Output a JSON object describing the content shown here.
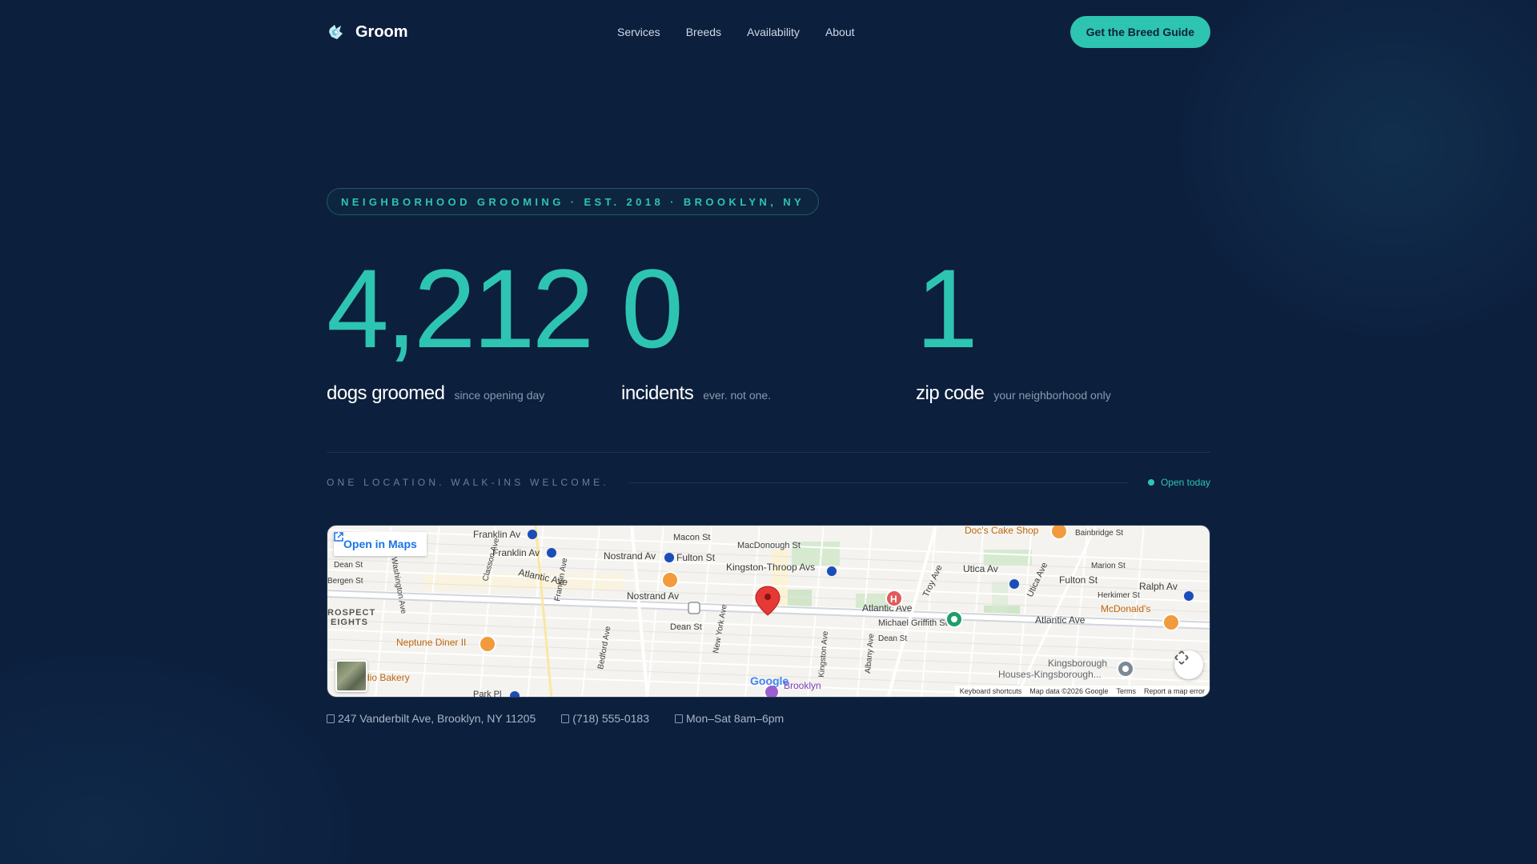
{
  "brand": {
    "name": "Groom"
  },
  "nav": {
    "links": [
      "Services",
      "Breeds",
      "Availability",
      "About"
    ],
    "cta": "Get the Breed Guide"
  },
  "hero": {
    "tagline": "NEIGHBORHOOD GROOMING · EST. 2018 · BROOKLYN, NY"
  },
  "stats": [
    {
      "value": "4,212",
      "label": "dogs groomed",
      "sub": "since opening day"
    },
    {
      "value": "0",
      "label": "incidents",
      "sub": "ever. not one."
    },
    {
      "value": "1",
      "label": "zip code",
      "sub": "your neighborhood only"
    }
  ],
  "location": {
    "title": "ONE LOCATION. WALK-INS WELCOME.",
    "status": "Open today",
    "map": {
      "open_in_maps": "Open in Maps",
      "labels": {
        "franklin_av_1": "Franklin Av",
        "franklin_av_2": "Franklin Av",
        "nostrand_av_1": "Nostrand Av",
        "fulton_st_1": "Fulton St",
        "macon_st": "Macon St",
        "macdonough_st": "MacDonough St",
        "kingston_throop": "Kingston-Throop Avs",
        "docs_cake": "Doc's Cake Shop",
        "bainbridge_st": "Bainbridge St",
        "marion_st": "Marion St",
        "utica_av_1": "Utica Av",
        "fulton_st_2": "Fulton St",
        "ralph_av": "Ralph Av",
        "herkimer_st": "Herkimer St",
        "mcdonalds": "McDonald's",
        "atlantic_ave_1": "Atlantic Ave",
        "atlantic_ave_2": "Atlantic Ave",
        "atlantic_ave_3": "Atlantic Ave",
        "nostrand_av_2": "Nostrand Av",
        "michael_griffith": "Michael Griffith St",
        "dean_st_1": "Dean St",
        "dean_st_2": "Dean St",
        "dean_st_3": "Dean St",
        "bergen_st": "Bergen St",
        "prospect_heights_1": "ROSPECT",
        "prospect_heights_2": "EIGHTS",
        "neptune_diner": "Neptune Diner II",
        "bakery": "dio Bakery",
        "park_pl": "Park Pl",
        "washington_ave": "Washington Ave",
        "classon_ave": "Classon Ave",
        "franklin_ave_v": "Franklin Ave",
        "bedford_ave": "Bedford Ave",
        "new_york_ave": "New York Ave",
        "kingston_ave": "Kingston Ave",
        "albany_ave": "Albany Ave",
        "troy_ave": "Troy Ave",
        "utica_ave_v": "Utica Ave",
        "kingsborough_1": "Kingsborough",
        "kingsborough_2": "Houses-Kingsborough...",
        "brooklyn": "Brooklyn"
      },
      "attribution": [
        "Keyboard shortcuts",
        "Map data ©2026 Google",
        "Terms",
        "Report a map error"
      ],
      "logo": "Google"
    }
  },
  "info": {
    "address": "247 Vanderbilt Ave, Brooklyn, NY 11205",
    "phone": "(718) 555-0183",
    "hours": "Mon–Sat 8am–6pm"
  },
  "colors": {
    "accent": "#2ec4b2",
    "background": "#0c1f3d",
    "pin": "#e53935"
  }
}
